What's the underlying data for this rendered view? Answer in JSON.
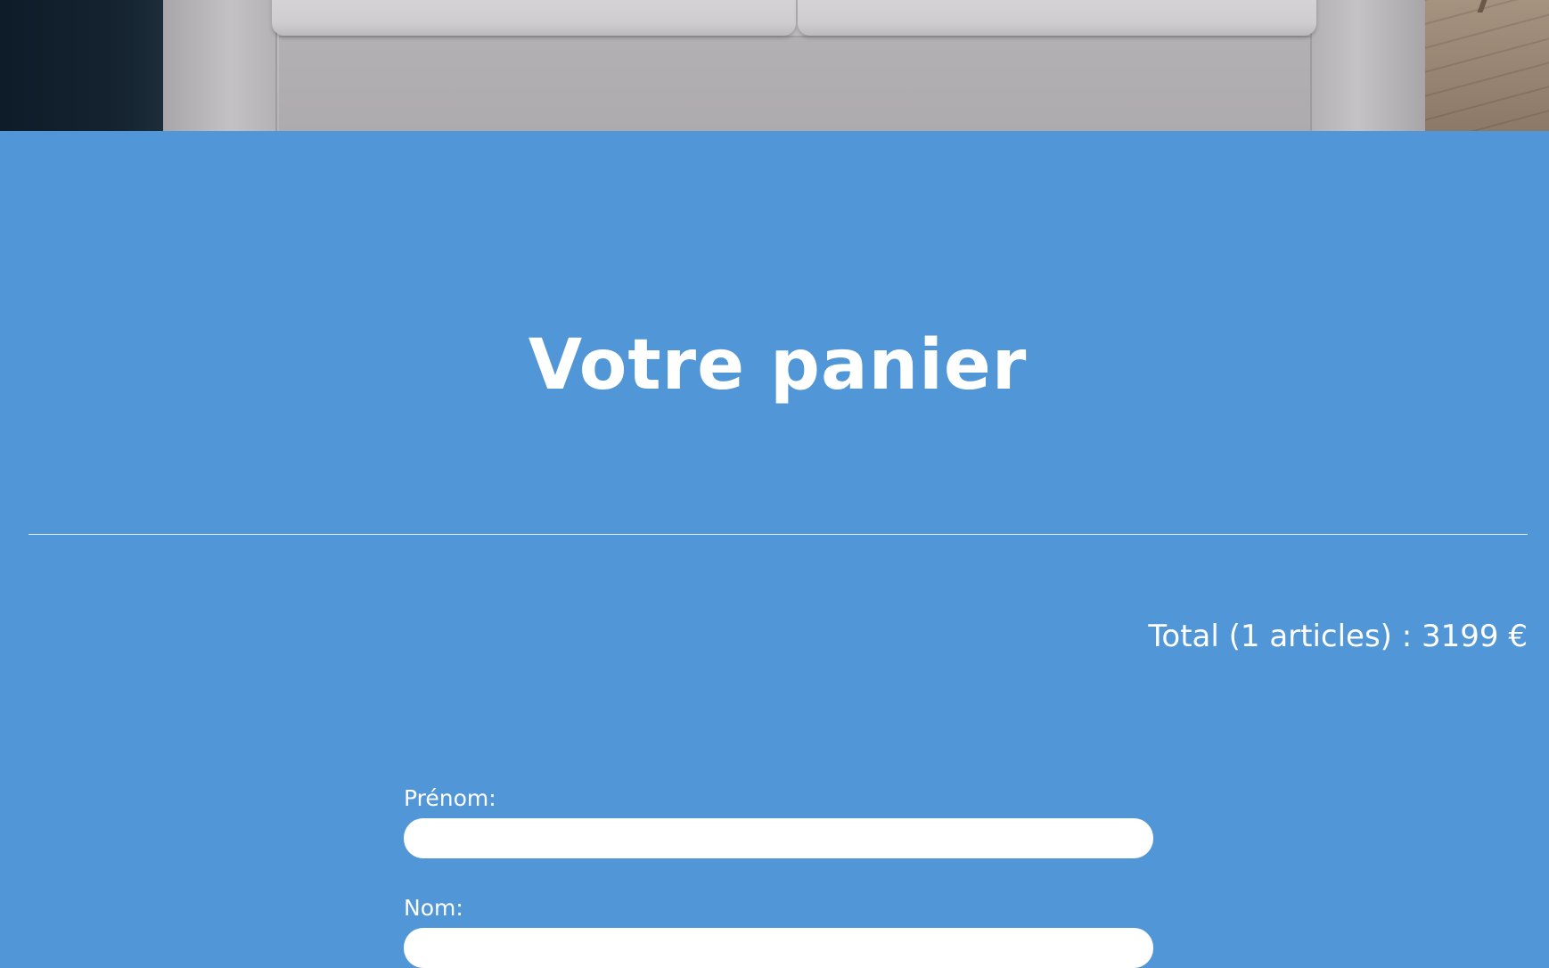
{
  "hero": {
    "image": "sofa-photo"
  },
  "cart": {
    "title": "Votre panier",
    "total_text": "Total (1 articles) : 3199 €"
  },
  "form": {
    "first_name": {
      "label": "Prénom:",
      "value": "",
      "placeholder": ""
    },
    "last_name": {
      "label": "Nom:",
      "value": "",
      "placeholder": ""
    }
  },
  "colors": {
    "background": "#5196d6",
    "text": "#ffffff",
    "input_background": "#ffffff"
  }
}
